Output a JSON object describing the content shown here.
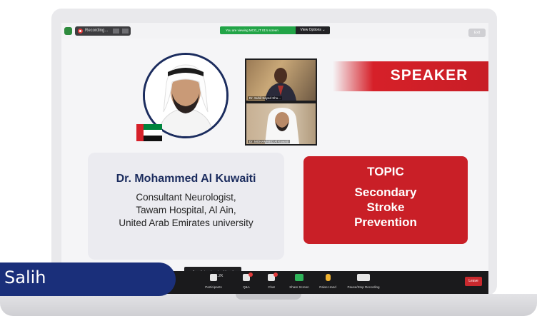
{
  "zoom": {
    "recording_label": "Recording...",
    "viewing_banner": "You are viewing MCG_IT 01's screen",
    "view_options_label": "View Options ⌄",
    "exit_label": "Exit"
  },
  "slide": {
    "speaker_heading": "SPEAKER",
    "speaker_name": "Dr. Mohammed Al Kuwaiti",
    "speaker_role_line1": "Consultant Neurologist,",
    "speaker_role_line2": "Tawam Hospital, Al Ain,",
    "speaker_role_line3": "United Arab Emirates university",
    "topic_label": "TOPIC",
    "topic_line1": "Secondary",
    "topic_line2": "Stroke",
    "topic_line3": "Prevention",
    "video_tile_1_name": "Dr. Suhil Sayed Shu...",
    "video_tile_2_name": "Dr. MOHAMMED Al Kuwaiti"
  },
  "toolbar": {
    "participants_label": "Participants",
    "participants_count": "1.2K",
    "qa_label": "Q&A",
    "chat_label": "Chat",
    "share_label": "Share Screen",
    "raise_hand_label": "Raise Hand",
    "recording_label": "Pause/Stop Recording",
    "leave_label": "Leave",
    "tooltip": "4 participants raised hand"
  },
  "caption": {
    "name": "Salih"
  },
  "colors": {
    "brand_red": "#cc1f28",
    "navy": "#1b2c5e",
    "caption_blue": "#1a2f7a",
    "zoom_green": "#22a447"
  }
}
